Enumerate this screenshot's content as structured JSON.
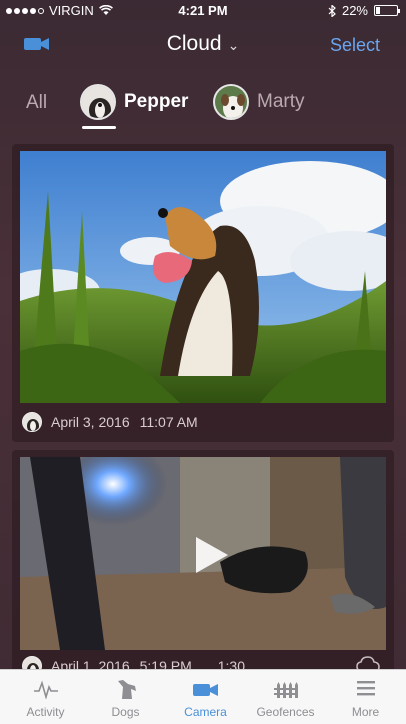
{
  "status_bar": {
    "carrier": "VIRGIN",
    "time": "4:21 PM",
    "battery": "22%",
    "battery_level": 0.22
  },
  "nav": {
    "title": "Cloud",
    "select_label": "Select"
  },
  "filter_tabs": [
    {
      "label": "All",
      "active": false
    },
    {
      "label": "Pepper",
      "active": true
    },
    {
      "label": "Marty",
      "active": false
    }
  ],
  "feed": [
    {
      "date": "April 3, 2016",
      "time": "11:07 AM",
      "type": "photo"
    },
    {
      "date": "April 1, 2016",
      "time": "5:19 PM",
      "duration": "1:30",
      "type": "video"
    }
  ],
  "tab_bar": {
    "items": [
      {
        "label": "Activity",
        "icon": "activity-icon",
        "active": false
      },
      {
        "label": "Dogs",
        "icon": "dog-icon",
        "active": false
      },
      {
        "label": "Camera",
        "icon": "camera-icon",
        "active": true
      },
      {
        "label": "Geofences",
        "icon": "fence-icon",
        "active": false
      },
      {
        "label": "More",
        "icon": "menu-icon",
        "active": false
      }
    ]
  },
  "colors": {
    "accent": "#4a90d9",
    "select": "#6aa6f0",
    "background": "#3f2a33"
  }
}
